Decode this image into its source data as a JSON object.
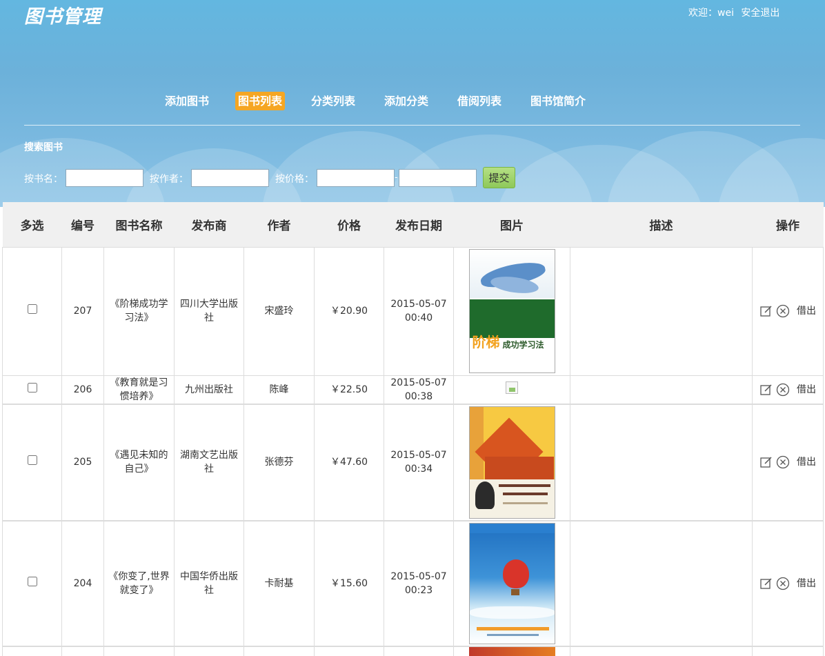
{
  "header": {
    "app_title": "图书管理",
    "welcome": "欢迎：wei",
    "logout": "安全退出"
  },
  "nav": [
    {
      "label": "添加图书",
      "active": false
    },
    {
      "label": "图书列表",
      "active": true
    },
    {
      "label": "分类列表",
      "active": false
    },
    {
      "label": "添加分类",
      "active": false
    },
    {
      "label": "借阅列表",
      "active": false
    },
    {
      "label": "图书馆简介",
      "active": false
    }
  ],
  "search": {
    "title": "搜索图书",
    "by_name_label": "按书名：",
    "by_author_label": "按作者：",
    "by_price_label": "按价格：",
    "dash": "-",
    "submit_label": "提交",
    "name_value": "",
    "author_value": "",
    "price_min_value": "",
    "price_max_value": ""
  },
  "table": {
    "headers": [
      "多选",
      "编号",
      "图书名称",
      "发布商",
      "作者",
      "价格",
      "发布日期",
      "图片",
      "描述",
      "操作"
    ],
    "rows": [
      {
        "id": "207",
        "name": "《阶梯成功学习法》",
        "publisher": "四川大学出版社",
        "author": "宋盛玲",
        "price": "￥20.90",
        "date": "2015-05-07",
        "time": "00:40",
        "cover": "steps",
        "desc": "",
        "borrow": "借出"
      },
      {
        "id": "206",
        "name": "《教育就是习惯培养》",
        "publisher": "九州出版社",
        "author": "陈峰",
        "price": "￥22.50",
        "date": "2015-05-07",
        "time": "00:38",
        "cover": "broken",
        "desc": "",
        "borrow": "借出"
      },
      {
        "id": "205",
        "name": "《遇见未知的自己》",
        "publisher": "湖南文艺出版社",
        "author": "张德芬",
        "price": "￥47.60",
        "date": "2015-05-07",
        "time": "00:34",
        "cover": "unknown-self",
        "desc": "",
        "borrow": "借出"
      },
      {
        "id": "204",
        "name": "《你变了,世界就变了》",
        "publisher": "中国华侨出版社",
        "author": "卡耐基",
        "price": "￥15.60",
        "date": "2015-05-07",
        "time": "00:23",
        "cover": "balloon",
        "desc": "",
        "borrow": "借出"
      }
    ]
  },
  "icons": {
    "edit": "edit-icon",
    "delete": "delete-icon"
  },
  "colors": {
    "sky": "#63b7e0",
    "active_nav": "#f5a623",
    "submit": "#9fd36b"
  }
}
